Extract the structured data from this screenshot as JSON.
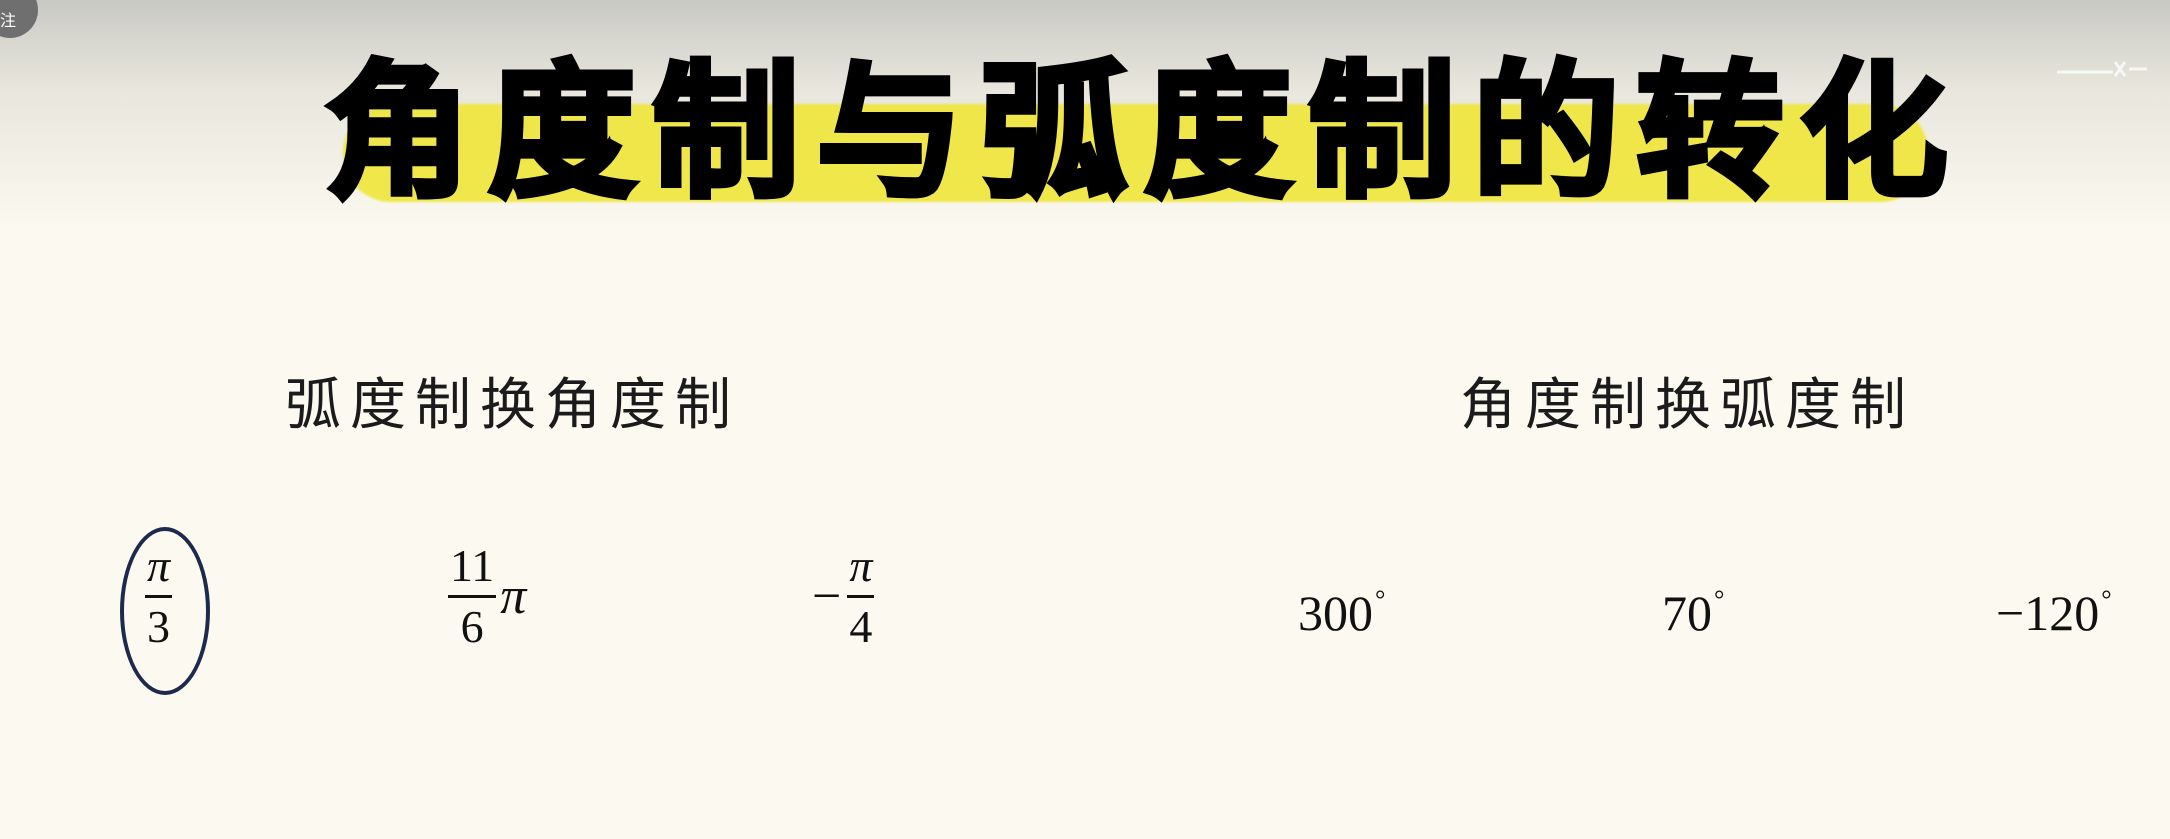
{
  "badge": {
    "text": "注"
  },
  "title": "角度制与弧度制的转化",
  "sections": {
    "left_heading": "弧度制换角度制",
    "right_heading": "角度制换弧度制"
  },
  "radian_items": [
    {
      "numerator": "π",
      "denominator": "3"
    },
    {
      "numerator": "11",
      "denominator": "6",
      "suffix": "π"
    },
    {
      "sign": "−",
      "numerator": "π",
      "denominator": "4"
    }
  ],
  "degree_items": [
    {
      "value": "300",
      "unit": "°"
    },
    {
      "value": "70",
      "unit": "°"
    },
    {
      "value": "−120",
      "unit": "°"
    }
  ],
  "colors": {
    "background": "#fcfaf0",
    "title_highlight": "#f0e63a",
    "circle_mark": "#1d2a4d"
  }
}
